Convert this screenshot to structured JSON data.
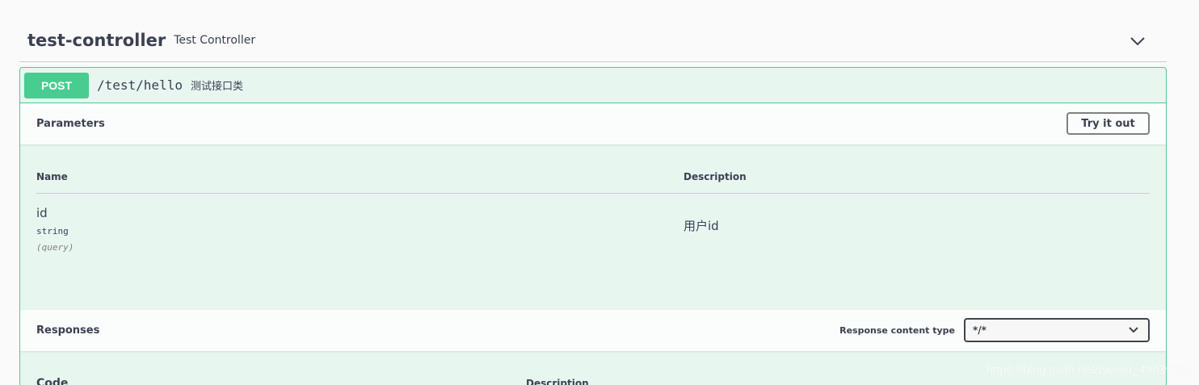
{
  "tag": {
    "name": "test-controller",
    "description": "Test Controller",
    "chevron_icon": "chevron-down-icon"
  },
  "operation": {
    "method": "POST",
    "path": "/test/hello",
    "summary": "测试接口类",
    "method_color": "#49cc90",
    "background_color": "#e8f6f0"
  },
  "parameters": {
    "title": "Parameters",
    "try_label": "Try it out",
    "columns": {
      "name": "Name",
      "description": "Description"
    },
    "rows": [
      {
        "name": "id",
        "type": "string",
        "in": "(query)",
        "description": "用户id"
      }
    ]
  },
  "responses": {
    "title": "Responses",
    "content_type_label": "Response content type",
    "content_type_value": "*/*",
    "columns": {
      "code": "Code",
      "description": "Description"
    }
  },
  "watermark": "https://blog.csdn.net/weixin_49939191"
}
